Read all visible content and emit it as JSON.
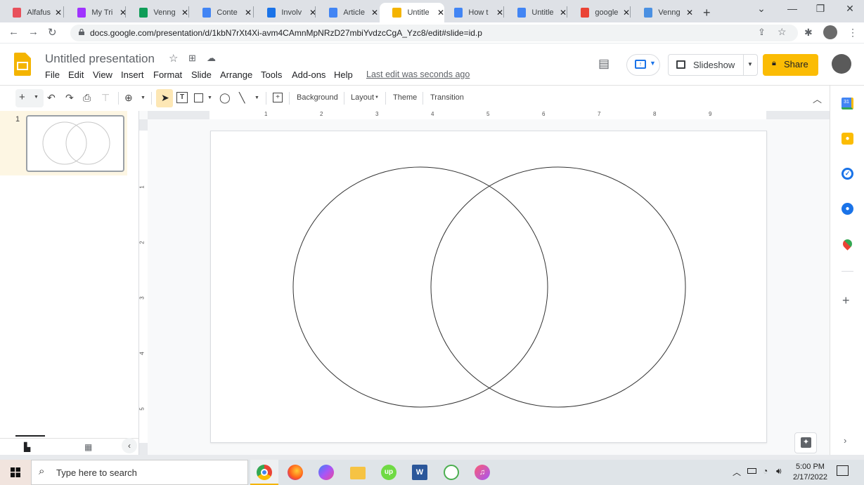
{
  "browser": {
    "tabs": [
      {
        "title": "Alfafus",
        "icon": "alfafus-icon",
        "color": "#e8505b"
      },
      {
        "title": "My Tri",
        "icon": "messenger-icon",
        "color": "#a033ff"
      },
      {
        "title": "Venng",
        "icon": "google-sheets-icon",
        "color": "#0f9d58"
      },
      {
        "title": "Conte",
        "icon": "google-docs-icon",
        "color": "#4285f4"
      },
      {
        "title": "Involv",
        "icon": "involve-icon",
        "color": "#1a73e8"
      },
      {
        "title": "Article",
        "icon": "google-docs-icon",
        "color": "#4285f4"
      },
      {
        "title": "Untitle",
        "icon": "google-slides-icon",
        "color": "#f4b400",
        "active": true
      },
      {
        "title": "How t",
        "icon": "how-to-icon",
        "color": "#4285f4"
      },
      {
        "title": "Untitle",
        "icon": "google-docs-icon",
        "color": "#4285f4"
      },
      {
        "title": "google",
        "icon": "google-icon",
        "color": "#ea4335"
      },
      {
        "title": "Venng",
        "icon": "venngage-icon",
        "color": "#4a90e2"
      }
    ],
    "url": "docs.google.com/presentation/d/1kbN7rXt4Xi-avm4CAmnMpNRzD27mbiYvdzcCgA_Yzc8/edit#slide=id.p"
  },
  "app": {
    "title": "Untitled presentation",
    "menus": [
      "File",
      "Edit",
      "View",
      "Insert",
      "Format",
      "Slide",
      "Arrange",
      "Tools",
      "Add-ons",
      "Help"
    ],
    "last_edit": "Last edit was seconds ago",
    "slideshow_label": "Slideshow",
    "share_label": "Share",
    "accent": "#fbbc04"
  },
  "toolbar": {
    "background_label": "Background",
    "layout_label": "Layout",
    "theme_label": "Theme",
    "transition_label": "Transition"
  },
  "ruler": {
    "h_ticks": [
      "1",
      "2",
      "3",
      "4",
      "5",
      "6",
      "7",
      "8",
      "9"
    ],
    "v_ticks": [
      "1",
      "2",
      "3",
      "4",
      "5"
    ]
  },
  "filmstrip": {
    "slides": [
      {
        "number": "1"
      }
    ]
  },
  "slide": {
    "shapes": [
      {
        "type": "ellipse",
        "name": "left-circle"
      },
      {
        "type": "ellipse",
        "name": "right-circle"
      }
    ]
  },
  "taskbar": {
    "search_placeholder": "Type here to search",
    "time": "5:00 PM",
    "date": "2/17/2022"
  }
}
